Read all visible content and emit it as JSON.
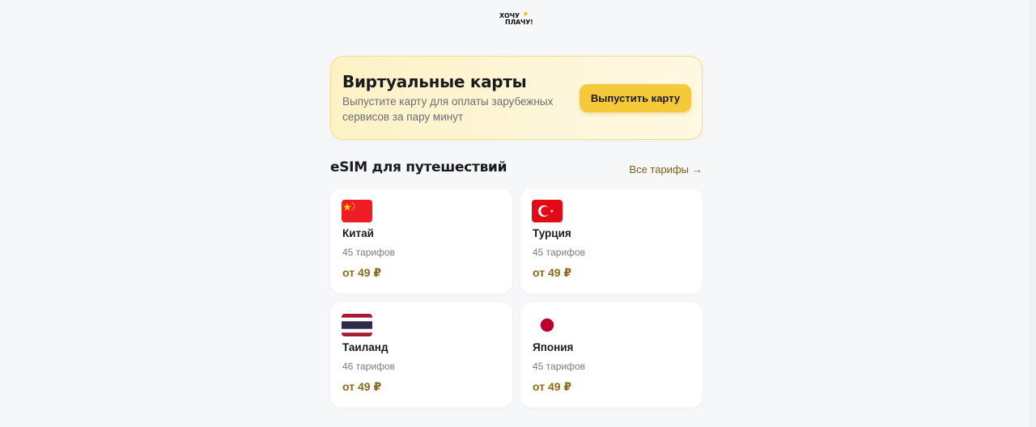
{
  "header": {
    "logo_line1": "ХОЧУ",
    "logo_line2": "ПЛАЧУ!"
  },
  "promo": {
    "title": "Виртуальные карты",
    "description": "Выпустите карту для оплаты зарубежных сервисов за пару минут",
    "button_label": "Выпустить карту"
  },
  "esim": {
    "section_title": "eSIM для путешествий",
    "all_link": "Все тарифы",
    "all_link_icon": "arrow-right-icon",
    "cards": [
      {
        "country": "Китай",
        "tariffs": "45 тарифов",
        "price": "от 49 ₽",
        "flag": "china-flag-icon"
      },
      {
        "country": "Турция",
        "tariffs": "45 тарифов",
        "price": "от 49 ₽",
        "flag": "turkey-flag-icon"
      },
      {
        "country": "Таиланд",
        "tariffs": "46 тарифов",
        "price": "от 49 ₽",
        "flag": "thailand-flag-icon"
      },
      {
        "country": "Япония",
        "tariffs": "45 тарифов",
        "price": "от 49 ₽",
        "flag": "japan-flag-icon"
      }
    ]
  },
  "colors": {
    "page_background": "#f6f7f9",
    "accent": "#f6c93b",
    "price": "#8a6a1a",
    "link": "#7a5f19"
  }
}
